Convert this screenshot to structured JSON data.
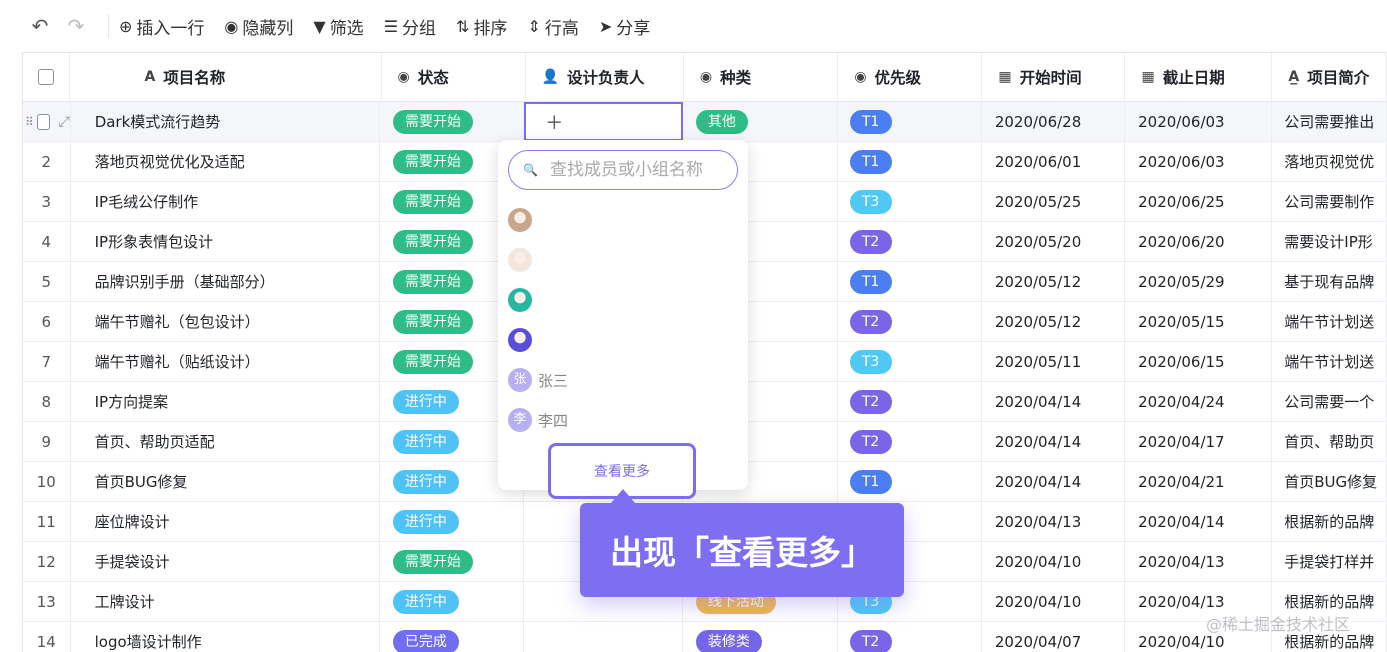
{
  "toolbar": {
    "items": [
      {
        "icon": "plus-circle-icon",
        "glyph": "⊕",
        "label": "插入一行"
      },
      {
        "icon": "eye-icon",
        "glyph": "◉",
        "label": "隐藏列"
      },
      {
        "icon": "filter-icon",
        "glyph": "▼",
        "label": "筛选"
      },
      {
        "icon": "group-icon",
        "glyph": "☰",
        "label": "分组"
      },
      {
        "icon": "sort-icon",
        "glyph": "⇅",
        "label": "排序"
      },
      {
        "icon": "row-height-icon",
        "glyph": "⇕",
        "label": "行高"
      },
      {
        "icon": "share-icon",
        "glyph": "➤",
        "label": "分享"
      }
    ]
  },
  "columns": {
    "name": "项目名称",
    "status": "状态",
    "owner": "设计负责人",
    "type": "种类",
    "priority": "优先级",
    "start": "开始时间",
    "end": "截止日期",
    "desc": "项目简介"
  },
  "colors": {
    "need_start": "#2fbc86",
    "in_progress": "#4fc3f7",
    "done": "#6f6ef0",
    "other": "#2fbc86",
    "decoration": "#7565e8",
    "offline": "#f0b84b",
    "T1": "#4b7ef0",
    "T2": "#7a65e8",
    "T3": "#4fc8f5",
    "accent": "#7c6cf0"
  },
  "rows": [
    {
      "idx": "",
      "name": "Dark模式流行趋势",
      "status": "需要开始",
      "status_key": "need_start",
      "type": "其他",
      "type_key": "other",
      "priority": "T1",
      "start": "2020/06/28",
      "end": "2020/06/03",
      "desc": "公司需要推出"
    },
    {
      "idx": "2",
      "name": "落地页视觉优化及适配",
      "status": "需要开始",
      "status_key": "need_start",
      "type": "",
      "type_key": "",
      "priority": "T1",
      "start": "2020/06/01",
      "end": "2020/06/03",
      "desc": "落地页视觉优"
    },
    {
      "idx": "3",
      "name": "IP毛绒公仔制作",
      "status": "需要开始",
      "status_key": "need_start",
      "type": "",
      "type_key": "",
      "priority": "T3",
      "start": "2020/05/25",
      "end": "2020/06/25",
      "desc": "公司需要制作"
    },
    {
      "idx": "4",
      "name": "IP形象表情包设计",
      "status": "需要开始",
      "status_key": "need_start",
      "type": "",
      "type_key": "",
      "priority": "T2",
      "start": "2020/05/20",
      "end": "2020/06/20",
      "desc": "需要设计IP形"
    },
    {
      "idx": "5",
      "name": "品牌识别手册（基础部分）",
      "status": "需要开始",
      "status_key": "need_start",
      "type": "",
      "type_key": "",
      "priority": "T1",
      "start": "2020/05/12",
      "end": "2020/05/29",
      "desc": "基于现有品牌"
    },
    {
      "idx": "6",
      "name": "端午节赠礼（包包设计）",
      "status": "需要开始",
      "status_key": "need_start",
      "type": "",
      "type_key": "",
      "priority": "T2",
      "start": "2020/05/12",
      "end": "2020/05/15",
      "desc": "端午节计划送"
    },
    {
      "idx": "7",
      "name": "端午节赠礼（贴纸设计）",
      "status": "需要开始",
      "status_key": "need_start",
      "type": "",
      "type_key": "",
      "priority": "T3",
      "start": "2020/05/11",
      "end": "2020/06/15",
      "desc": "端午节计划送"
    },
    {
      "idx": "8",
      "name": "IP方向提案",
      "status": "进行中",
      "status_key": "in_progress",
      "type": "",
      "type_key": "",
      "priority": "T2",
      "start": "2020/04/14",
      "end": "2020/04/24",
      "desc": "公司需要一个"
    },
    {
      "idx": "9",
      "name": "首页、帮助页适配",
      "status": "进行中",
      "status_key": "in_progress",
      "type": "",
      "type_key": "",
      "priority": "T2",
      "start": "2020/04/14",
      "end": "2020/04/17",
      "desc": "首页、帮助页"
    },
    {
      "idx": "10",
      "name": "首页BUG修复",
      "status": "进行中",
      "status_key": "in_progress",
      "type": "",
      "type_key": "",
      "priority": "T1",
      "start": "2020/04/14",
      "end": "2020/04/21",
      "desc": "首页BUG修复"
    },
    {
      "idx": "11",
      "name": "座位牌设计",
      "status": "进行中",
      "status_key": "in_progress",
      "type": "",
      "type_key": "",
      "priority": "",
      "start": "2020/04/13",
      "end": "2020/04/14",
      "desc": "根据新的品牌"
    },
    {
      "idx": "12",
      "name": "手提袋设计",
      "status": "需要开始",
      "status_key": "need_start",
      "type": "",
      "type_key": "",
      "priority": "",
      "start": "2020/04/10",
      "end": "2020/04/13",
      "desc": "手提袋打样并"
    },
    {
      "idx": "13",
      "name": "工牌设计",
      "status": "进行中",
      "status_key": "in_progress",
      "type": "线下活动",
      "type_key": "offline",
      "priority": "T3",
      "start": "2020/04/10",
      "end": "2020/04/13",
      "desc": "根据新的品牌"
    },
    {
      "idx": "14",
      "name": "logo墙设计制作",
      "status": "已完成",
      "status_key": "done",
      "type": "装修类",
      "type_key": "decoration",
      "priority": "T2",
      "start": "2020/04/07",
      "end": "2020/04/10",
      "desc": "根据新的品牌"
    }
  ],
  "dropdown": {
    "search_placeholder": "查找成员或小组名称",
    "members": [
      {
        "kind": "photo",
        "color": "#c9a58c",
        "name": ""
      },
      {
        "kind": "photo",
        "color": "#f3e6dc",
        "name": ""
      },
      {
        "kind": "photo",
        "color": "#27b6a0",
        "name": ""
      },
      {
        "kind": "photo",
        "color": "#5b4ed8",
        "name": ""
      },
      {
        "kind": "letter",
        "letter": "张",
        "name": "张三"
      },
      {
        "kind": "letter",
        "letter": "李",
        "name": "李四"
      }
    ],
    "more_label": "查看更多"
  },
  "callout": "出现「查看更多」",
  "watermark": "@稀土掘金技术社区"
}
